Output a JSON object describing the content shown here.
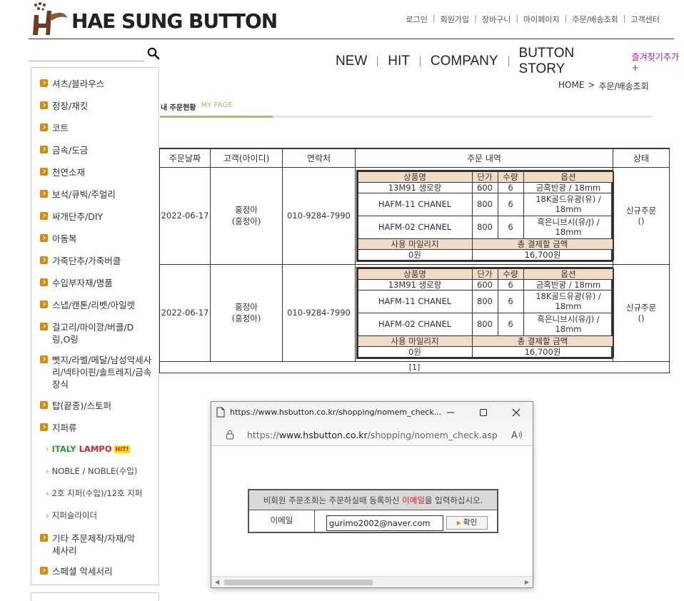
{
  "header": {
    "logo_text": "HAE SUNG BUTTON",
    "top_menu": [
      "로그인",
      "회원가입",
      "장바구니",
      "마이페이지",
      "주문/배송조회",
      "고객센터"
    ],
    "nav": [
      "NEW",
      "HIT",
      "COMPANY",
      "BUTTON STORY"
    ],
    "favorite": "즐겨찾기추가+"
  },
  "sidebar": {
    "items": [
      "셔츠/블라우스",
      "정장/재킷",
      "코트",
      "금속/도금",
      "천연소재",
      "보석/큐빅/주얼리",
      "싸개단추/DIY",
      "아동복",
      "가죽단추/가죽버클",
      "수입부자재/명품",
      "스냅/캔톤/리벳/아일렛",
      "걸고리/마이깡/버클/D링,O링",
      "뻿지/라벨/메달/남성악세사리/넥타이핀/솔트레지/금속장식",
      "탑(끝종)/스토퍼",
      "지퍼류"
    ],
    "sub_items": {
      "italy_1": "ITALY",
      "italy_2": "LAMPO",
      "hit": "HIT!",
      "noble": "NOBLE / NOBLE(수입)",
      "zipper2": "2호 지퍼(수입)/12호 지퍼",
      "slider": "지퍼슬라이더"
    },
    "items_after": [
      "기타 주문제작/자재/악세사리",
      "스페셜 악세서리"
    ]
  },
  "breadcrumb": {
    "home": "HOME",
    "sep": ">",
    "current": "주문/배송조회"
  },
  "tabs": {
    "active": "내 주문현황",
    "inactive": "MY PAGE"
  },
  "order_table": {
    "headers": [
      "주문날짜",
      "고객(아이디)",
      "연락처",
      "주문 내역",
      "상태"
    ],
    "inner_headers": [
      "상품명",
      "단가",
      "수량",
      "옵션"
    ],
    "summary_headers": [
      "사용 마일리지",
      "총 결제할 금액"
    ],
    "orders": [
      {
        "date": "2022-06-17",
        "customer": "홍정아",
        "customer_id": "(홍정아)",
        "phone": "010-9284-7990",
        "status": "신규주문",
        "status_sub": "()",
        "items": [
          {
            "name": "13M91 생로랑",
            "price": "600",
            "qty": "6",
            "option": "금흑반광 / 18mm"
          },
          {
            "name": "HAFM-11 CHANEL",
            "price": "800",
            "qty": "6",
            "option": "18K골드유광(유) / 18mm"
          },
          {
            "name": "HAFM-02 CHANEL",
            "price": "800",
            "qty": "6",
            "option": "흑은니브시(유/J) / 18mm"
          }
        ],
        "mileage": "0원",
        "total": "16,700원"
      },
      {
        "date": "2022-06-17",
        "customer": "홍정아",
        "customer_id": "(홍정아)",
        "phone": "010-9284-7990",
        "status": "신규주문",
        "status_sub": "()",
        "items": [
          {
            "name": "13M91 생로랑",
            "price": "600",
            "qty": "6",
            "option": "금흑반광 / 18mm"
          },
          {
            "name": "HAFM-11 CHANEL",
            "price": "800",
            "qty": "6",
            "option": "18K골드유광(유) / 18mm"
          },
          {
            "name": "HAFM-02 CHANEL",
            "price": "800",
            "qty": "6",
            "option": "흑은니브시(유/J) / 18mm"
          }
        ],
        "mileage": "0원",
        "total": "16,700원"
      }
    ],
    "pager": "[1]"
  },
  "popup": {
    "title": "https://www.hsbutton.co.kr/shopping/nomem_check...",
    "url_prefix": "https://",
    "url_domain": "www.hsbutton.co.kr",
    "url_path": "/shopping/nomem_check.asp",
    "msg_before": "비회원 주문조회는 주문하실때 등록하신 ",
    "msg_emph": "이메일",
    "msg_after": "을 입력하십시오.",
    "email_label": "이메일",
    "email_value": "gurimo2002@naver.com",
    "confirm_label": "확인"
  },
  "colors": {
    "accent": "#d18b19",
    "tab_active": "#b9b17b",
    "header_bg": "#f2dcc8",
    "emphasis": "#d0242a"
  }
}
